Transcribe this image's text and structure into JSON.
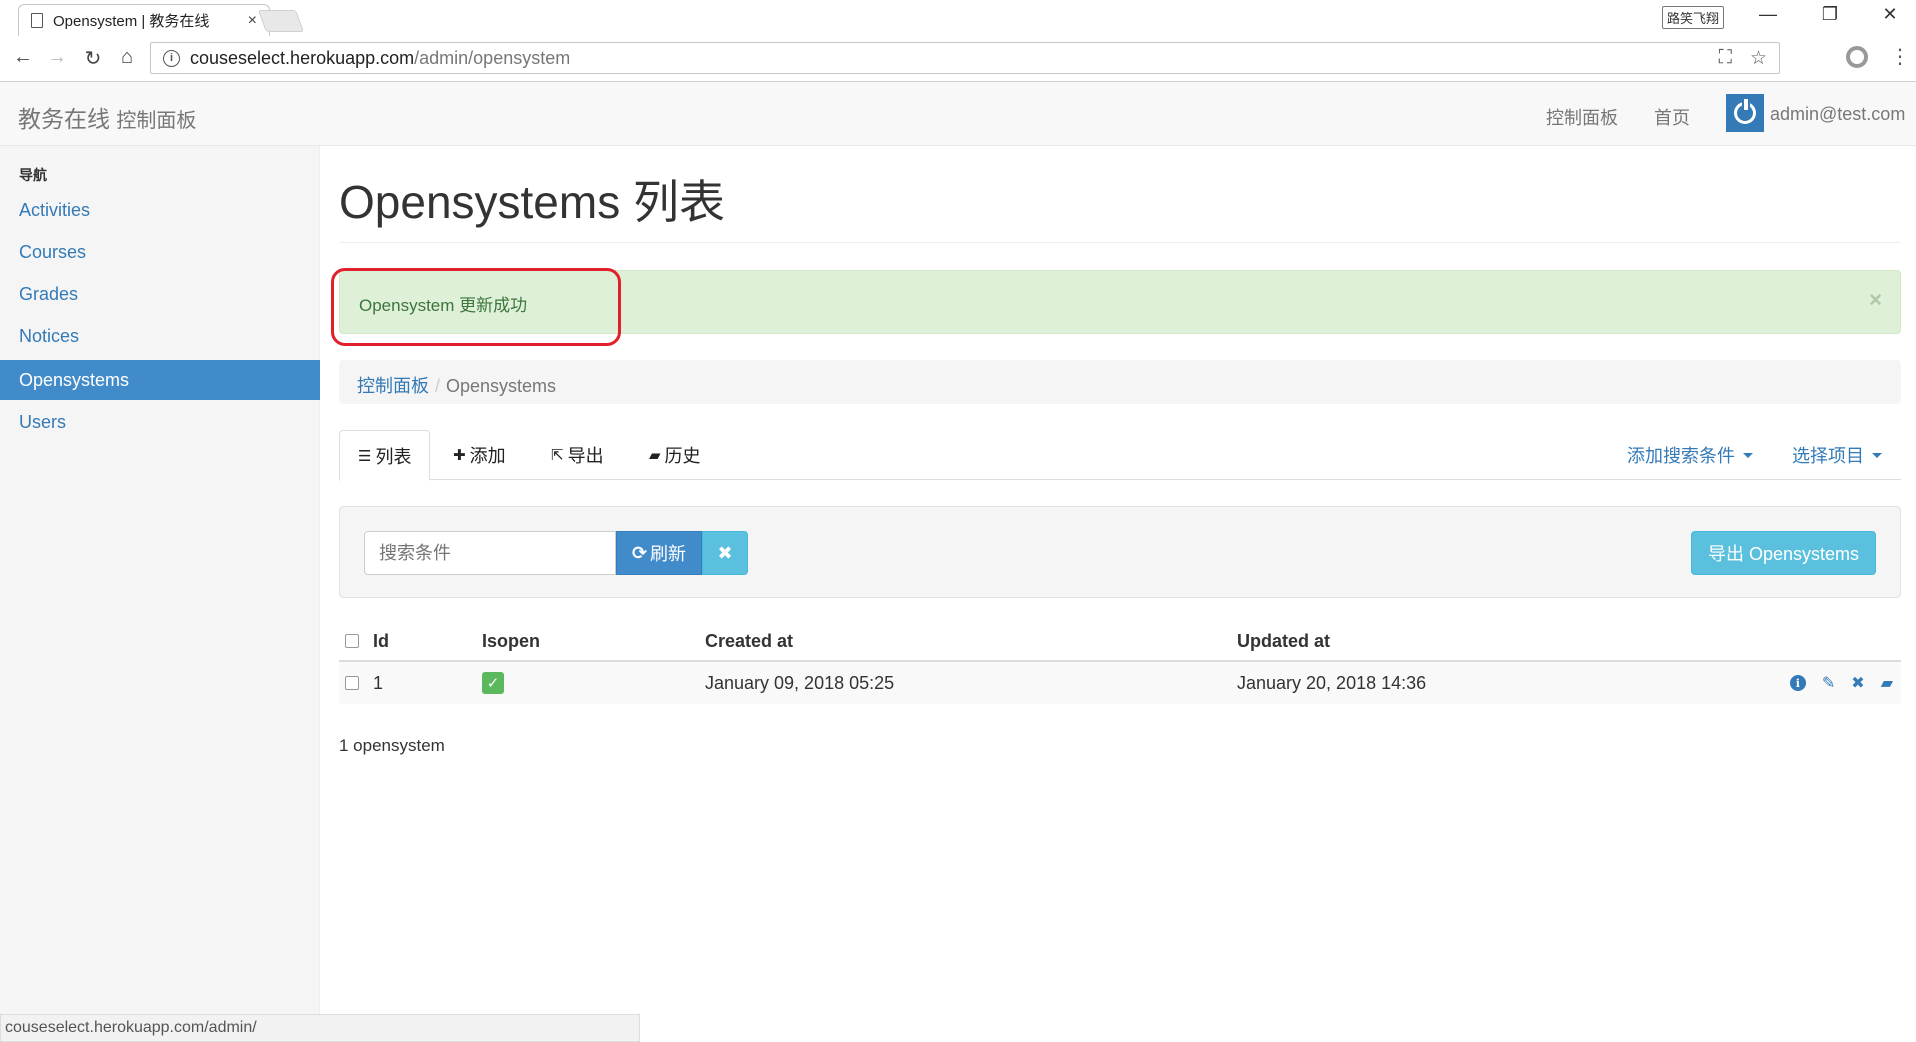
{
  "browser": {
    "tab_title": "Opensystem | 教务在线",
    "tab_close": "×",
    "window_user": "路笑飞翔",
    "window_controls": [
      "—",
      "❐",
      "✕"
    ],
    "url_host": "couseselect.herokuapp.com",
    "url_path": "/admin/opensystem",
    "status_url": "couseselect.herokuapp.com/admin/"
  },
  "navbar": {
    "brand": "教务在线",
    "brand_sub": "控制面板",
    "links": [
      "控制面板",
      "首页"
    ],
    "user_email": "admin@test.com"
  },
  "sidebar": {
    "header": "导航",
    "items": [
      {
        "label": "Activities",
        "active": false
      },
      {
        "label": "Courses",
        "active": false
      },
      {
        "label": "Grades",
        "active": false
      },
      {
        "label": "Notices",
        "active": false
      },
      {
        "label": "Opensystems",
        "active": true
      },
      {
        "label": "Users",
        "active": false
      }
    ]
  },
  "main": {
    "title": "Opensystems 列表",
    "alert": "Opensystem 更新成功",
    "alert_close": "×",
    "breadcrumb": {
      "link": "控制面板",
      "separator": "/",
      "current": "Opensystems"
    },
    "tabs": [
      {
        "label": "列表",
        "icon": "list-icon",
        "active": true
      },
      {
        "label": "添加",
        "icon": "plus-icon",
        "active": false
      },
      {
        "label": "导出",
        "icon": "export-icon",
        "active": false
      },
      {
        "label": "历史",
        "icon": "book-icon",
        "active": false
      }
    ],
    "dropdowns": [
      "添加搜索条件",
      "选择项目"
    ],
    "search": {
      "placeholder": "搜索条件",
      "refresh_label": "刷新",
      "clear_label": "✖",
      "export_label": "导出 Opensystems"
    },
    "table": {
      "columns": [
        "Id",
        "Isopen",
        "Created at",
        "Updated at"
      ],
      "rows": [
        {
          "id": "1",
          "isopen": true,
          "created_at": "January 09, 2018 05:25",
          "updated_at": "January 20, 2018 14:36"
        }
      ]
    },
    "count": "1 opensystem"
  },
  "colors": {
    "primary": "#337ab7",
    "active": "#428bca",
    "success_bg": "#dff0d8",
    "success_text": "#3c763d",
    "info": "#5bc0de",
    "highlight": "#e0202a"
  }
}
